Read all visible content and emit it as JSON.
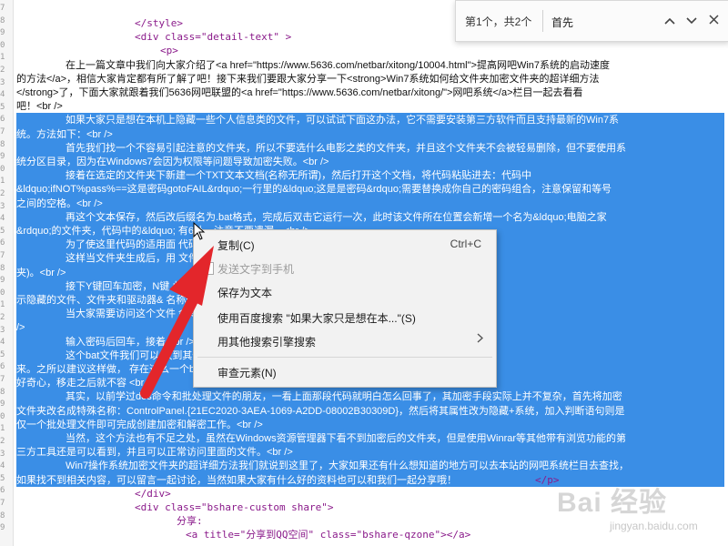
{
  "find_bar": {
    "count": "第1个，共2个",
    "query": "首先",
    "prev_label": "∧",
    "next_label": "∨",
    "close_label": "✕"
  },
  "gutter_numbers": [
    "7",
    "8",
    "9",
    "0",
    "1",
    "2",
    "3",
    "4",
    "5",
    "6",
    "7",
    "8",
    "9",
    "0",
    "1",
    "2",
    "3",
    "4",
    "5",
    "6",
    "7",
    "8",
    "9",
    "0",
    "1",
    "2",
    "3",
    "4",
    "5",
    "6",
    "7",
    "8",
    "9",
    "0",
    "1",
    "2",
    "3",
    "4",
    "5",
    "6",
    "7",
    "8",
    "9"
  ],
  "code": {
    "style_close": "</style>",
    "div_detail": "<div class=\"detail-text\"  >",
    "p_open": "<p>",
    "para1_a": "在上一篇文章中我们向大家介绍了<a href=\"https://www.5636.com/netbar/xitong/10004.html\">提高网吧Win7系统的启动速度",
    "para1_b": "的方法</a>，相信大家肯定都有所了解了吧！接下来我们要跟大家分享一下<strong>Win7系统如何给文件夹加密文件夹的超详细方法",
    "para1_c": "</strong>了，下面大家就跟着我们5636网吧联盟的<a href=\"https://www.5636.com/netbar/xitong/\">网吧系统</a>栏目一起去看看",
    "para1_d": "吧！<br />",
    "hl": [
      "如果大家只是想在本机上隐藏一些个人信息类的文件，可以试试下面这办法，它不需要安装第三方软件而且支持最新的Win7系",
      "统。方法如下：<br />",
      "首先我们找一个不容易引起注意的文件夹，所以不要选什么电影之类的文件夹，并且这个文件夹不会被轻易删除，但不要使用系",
      "统分区目录，因为在Windows7会因为权限等问题导致加密失败。<br />",
      "接着在选定的文件夹下新建一个TXT文本文档(名称无所谓)，然后打开这个文档，将代码粘贴进去：代码中",
      "&ldquo;ifNOT%pass%==这是密码gotoFAIL&rdquo;一行里的&ldquo;这是是密码&rdquo;需要替换成你自己的密码组合，注意保留和等号",
      "之间的空格。<br />",
      "再这个文本保存，然后改后缀名为.bat格式，完成后双击它运行一次，此时该文件所在位置会新增一个名为&ldquo;电脑之家",
      "&rdquo;的文件夹，代码中的&ldquo;                                          有6处，注意不要遗漏。<br />",
      "为了使这里代码的适用面                                         代码中文是为了便于说明。<br />",
      "这样当文件夹生成后，用                                          文件夹(指&ldquo;电脑之家&rdquo;文件",
      "夹)。<br />",
      "接下Y键回车加密，N键                                           此时，即使将系统文件夹设置改为&ldquo;显",
      "示隐藏的文件、文件夹和驱动器&                                    名称也无法访问。<br />",
      "当大家需要访问这个文件                                          命令窗口提示：要求你输入解锁密码。<br",
      "/>",
      "输入密码后回车，接着                                            <br />",
      "这个bat文件我们可以                                             放到其他地方保存，需要解密了在复制过",
      "来。之所以建议这样做，                                           存在这么一个bat文件反而会引起一些人的",
      "好奇心，移走之后就不容                                           <br />",
      "其实，以前学过dos命令和批处理文件的朋友，一看上面那段代码就明白怎么回事了，其加密手段实际上并不复杂，首先将加密",
      "文件夹改名成特殊名称：ControlPanel.{21EC2020-3AEA-1069-A2DD-08002B30309D}，然后将其属性改为隐藏+系统，加入判断语句则是",
      "仅一个批处理文件即可完成创建加密和解密工作。<br />",
      "当然，这个方法也有不足之处，虽然在Windows资源管理器下看不到加密后的文件夹，但是使用Winrar等其他带有浏览功能的第",
      "三方工具还是可以看到，并且可以正常访问里面的文件。<br />",
      "Win7操作系统加密文件夹的超详细方法我们就说到这里了，大家如果还有什么想知道的地方可以去本站的网吧系统栏目去查找，",
      "如果找不到相关内容，可以留言一起讨论，当然如果大家有什么好的资料也可以和我们一起分享哦！"
    ],
    "hl_end_tag": "</p>",
    "div_close": "</div>",
    "div_share": "<div class=\"bshare-custom share\">",
    "share_label": "分享:",
    "share_a": "<a title=\"分享到QQ空间\" class=\"bshare-qzone\"></a>"
  },
  "context_menu": {
    "copy": "复制(C)",
    "copy_shortcut": "Ctrl+C",
    "send_phone": "发送文字到手机",
    "save_text": "保存为文本",
    "baidu_search": "使用百度搜索 \"如果大家只是想在本...\"(S)",
    "other_search": "用其他搜索引擎搜索",
    "inspect": "审查元素(N)"
  },
  "watermark": {
    "brand": "Bai  经验",
    "sub": "jingyan.baidu.com"
  },
  "colors": {
    "selection": "#3a8ee6",
    "arrow": "#e3262b",
    "tag": "#8a1a8a"
  }
}
